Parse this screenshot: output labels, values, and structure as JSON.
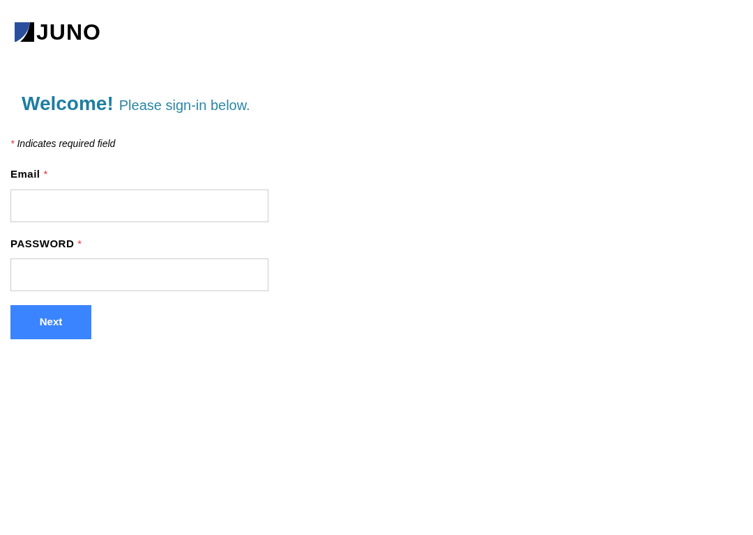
{
  "logo": {
    "text": "JUNO"
  },
  "welcome": {
    "title": "Welcome!",
    "subtitle": "Please sign-in below."
  },
  "required_note": {
    "mark": "*",
    "text": "Indicates required field"
  },
  "fields": [
    {
      "label": "Email",
      "required_mark": "*"
    },
    {
      "label": "PASSWORD",
      "required_mark": "*"
    }
  ],
  "submit_button": {
    "label": "Next"
  }
}
